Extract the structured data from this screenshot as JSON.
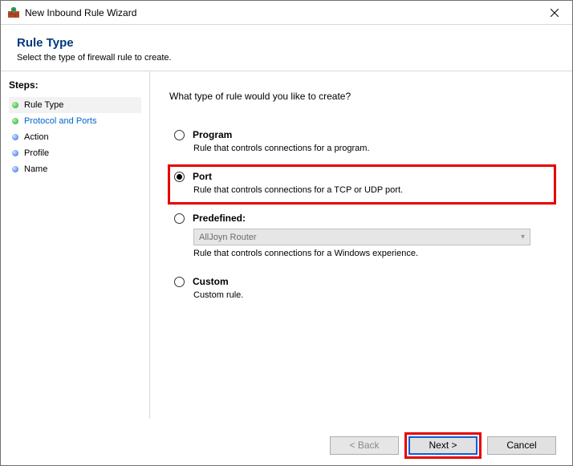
{
  "window": {
    "title": "New Inbound Rule Wizard"
  },
  "header": {
    "title": "Rule Type",
    "subtitle": "Select the type of firewall rule to create."
  },
  "sidebar": {
    "steps_label": "Steps:",
    "steps": [
      {
        "label": "Rule Type"
      },
      {
        "label": "Protocol and Ports"
      },
      {
        "label": "Action"
      },
      {
        "label": "Profile"
      },
      {
        "label": "Name"
      }
    ]
  },
  "content": {
    "prompt": "What type of rule would you like to create?",
    "options": {
      "program": {
        "title": "Program",
        "desc": "Rule that controls connections for a program."
      },
      "port": {
        "title": "Port",
        "desc": "Rule that controls connections for a TCP or UDP port."
      },
      "predefined": {
        "title": "Predefined:",
        "selected": "AllJoyn Router",
        "desc": "Rule that controls connections for a Windows experience."
      },
      "custom": {
        "title": "Custom",
        "desc": "Custom rule."
      }
    }
  },
  "footer": {
    "back": "< Back",
    "next": "Next >",
    "cancel": "Cancel"
  }
}
